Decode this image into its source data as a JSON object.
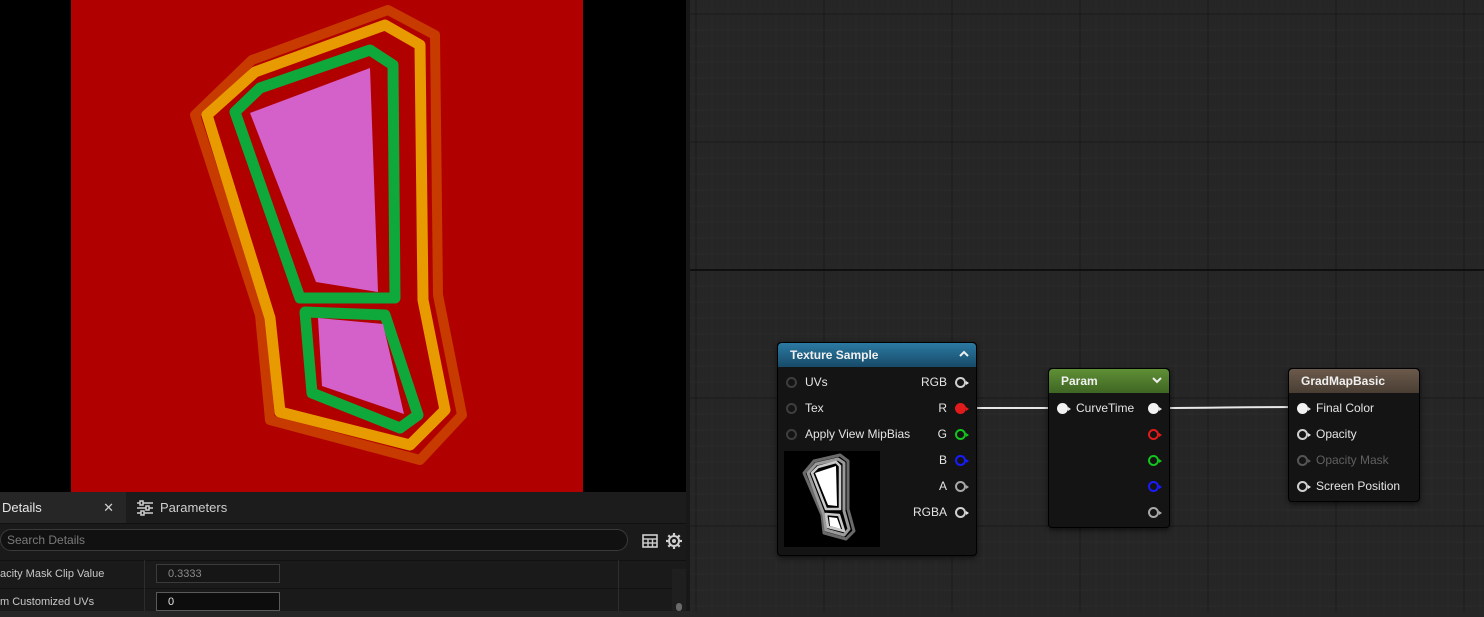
{
  "details": {
    "tabs": {
      "details": "Details",
      "parameters": "Parameters"
    },
    "search_placeholder": "Search Details",
    "properties": [
      {
        "label": "acity Mask Clip Value",
        "value": "0.3333"
      },
      {
        "label": "m Customized UVs",
        "value": "0"
      }
    ]
  },
  "nodes": {
    "texture_sample": {
      "title": "Texture Sample",
      "inputs": [
        "UVs",
        "Tex",
        "Apply View MipBias"
      ],
      "outputs": [
        "RGB",
        "R",
        "G",
        "B",
        "A",
        "RGBA"
      ]
    },
    "param": {
      "title": "Param",
      "input": "CurveTime"
    },
    "grad_map": {
      "title": "GradMapBasic",
      "inputs": [
        "Final Color",
        "Opacity",
        "Opacity Mask",
        "Screen Position"
      ]
    }
  },
  "colors": {
    "preview_background": "#b00000",
    "texture_header": "#1f5a7a",
    "param_header": "#4f7a2e",
    "result_header": "#5a4a3e",
    "pin_red": "#e11b1b",
    "pin_green": "#13c41e",
    "pin_blue": "#1a1aff"
  }
}
